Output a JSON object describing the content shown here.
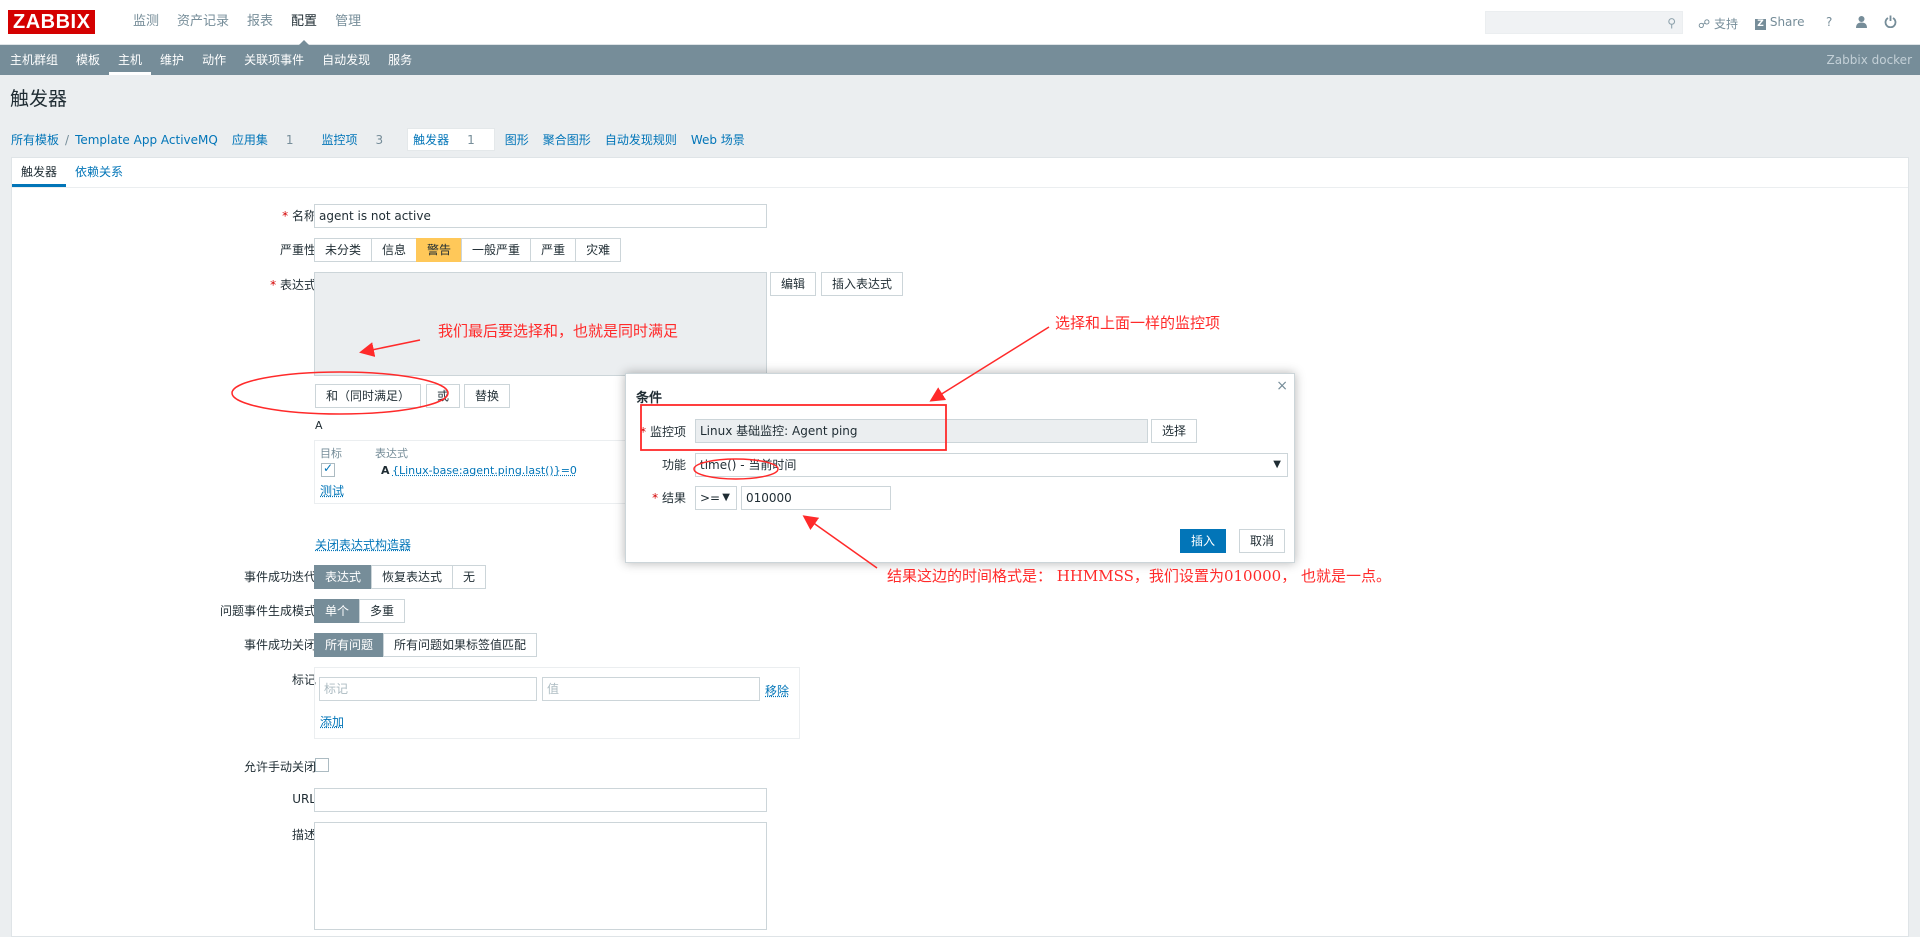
{
  "header": {
    "logo": "ZABBIX",
    "menu": [
      "监测",
      "资产记录",
      "报表",
      "配置",
      "管理"
    ],
    "menu_selected": 3,
    "support": "支持",
    "share": "Share",
    "help": "?",
    "search_icon": "search-icon",
    "support_icon": "headset-icon",
    "share_icon": "share-z-icon",
    "user_icon": "user-icon",
    "power_icon": "power-icon"
  },
  "submenu": {
    "items": [
      "主机群组",
      "模板",
      "主机",
      "维护",
      "动作",
      "关联项事件",
      "自动发现",
      "服务"
    ],
    "selected": 2,
    "right": "Zabbix docker"
  },
  "page": {
    "title": "触发器"
  },
  "breadcrumb": {
    "all_templates": "所有模板",
    "sep": "/",
    "template": "Template App ActiveMQ",
    "applications": "应用集",
    "applications_count": "1",
    "items": "监控项",
    "items_count": "3",
    "triggers": "触发器",
    "triggers_count": "1",
    "graphs": "图形",
    "screens": "聚合图形",
    "discovery": "自动发现规则",
    "web": "Web 场景"
  },
  "tabs": [
    "触发器",
    "依赖关系"
  ],
  "form": {
    "name_label": "名称",
    "name_value": "agent is not active",
    "severity_label": "严重性",
    "severity": [
      "未分类",
      "信息",
      "警告",
      "一般严重",
      "严重",
      "灾难"
    ],
    "severity_selected": 2,
    "expression_label": "表达式",
    "edit_btn": "编辑",
    "insert_expr_btn": "插入表达式",
    "and_btn": "和（同时满足）",
    "or_btn": "或",
    "replace_btn": "替换",
    "expr_letter": "A",
    "table_head_target": "目标",
    "table_head_expr": "表达式",
    "row_letter": "A",
    "row_expr": "{Linux-base:agent.ping.last()}=0",
    "test_link": "测试",
    "close_builder": "关闭表达式构造器",
    "ok_event_label": "事件成功迭代",
    "ok_event": [
      "表达式",
      "恢复表达式",
      "无"
    ],
    "problem_mode_label": "问题事件生成模式",
    "problem_mode": [
      "单个",
      "多重"
    ],
    "ok_close_label": "事件成功关闭",
    "ok_close": [
      "所有问题",
      "所有问题如果标签值匹配"
    ],
    "tags_label": "标记",
    "tag_placeholder": "标记",
    "value_placeholder": "值",
    "remove_link": "移除",
    "add_link": "添加",
    "manual_close_label": "允许手动关闭",
    "url_label": "URL",
    "desc_label": "描述"
  },
  "dialog": {
    "title": "条件",
    "close": "×",
    "item_label": "监控项",
    "item_value": "Linux 基础监控: Agent ping",
    "select_btn": "选择",
    "function_label": "功能",
    "function_value": "time() - 当前时间",
    "result_label": "结果",
    "operator": ">=",
    "result_value": "010000",
    "insert_btn": "插入",
    "cancel_btn": "取消"
  },
  "annotations": {
    "a1": "我们最后要选择和，也就是同时满足",
    "a2": "选择和上面一样的监控项",
    "a3": "结果这边的时间格式是： HHMMSS，我们设置为010000， 也就是一点。",
    "color": "#ff2a2a"
  }
}
